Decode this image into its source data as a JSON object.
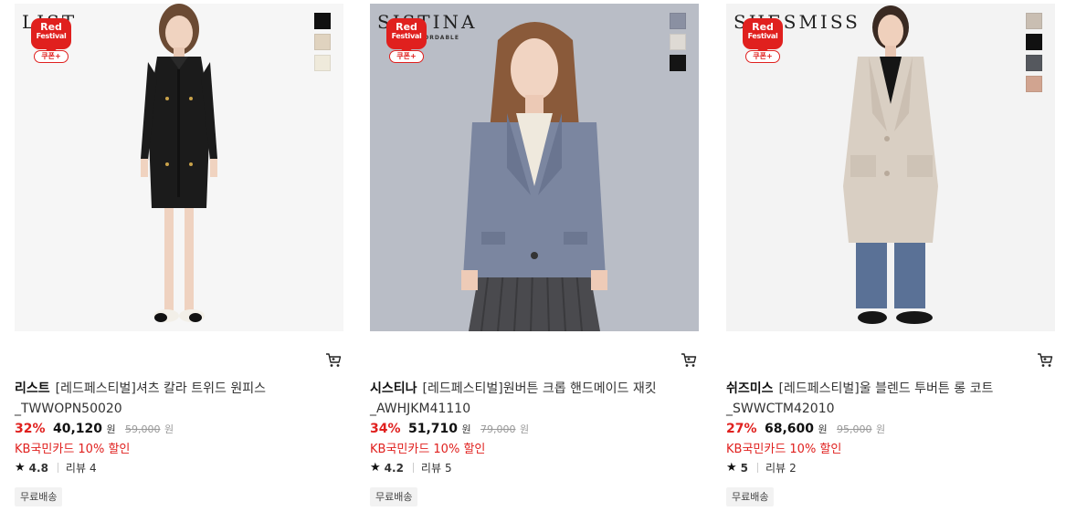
{
  "products": [
    {
      "brand_logo_text": "LIST",
      "brand_logo_sub": "",
      "badge": {
        "line1": "Red",
        "line2": "Festival",
        "coupon": "쿠폰+"
      },
      "swatches": [
        "#111111",
        "#e0d3bf",
        "#efeadb"
      ],
      "image_bg": "#f6f6f6",
      "brand": "리스트",
      "name": "[레드페스티벌]셔츠 칼라 트위드 원피스 _TWWOPN50020",
      "discount": "32%",
      "price": "40,120",
      "currency": "원",
      "original_price": "59,000",
      "card_promo": "KB국민카드 10% 할인",
      "rating": "4.8",
      "review_label": "리뷰",
      "review_count": "4",
      "shipping": "무료배송"
    },
    {
      "brand_logo_text": "SISTINA",
      "brand_logo_sub": "FORDABLE",
      "badge": {
        "line1": "Red",
        "line2": "Festival",
        "coupon": "쿠폰+"
      },
      "swatches": [
        "#8a90a2",
        "#dedad4",
        "#151515"
      ],
      "image_bg": "#b9bdc6",
      "brand": "시스티나",
      "name": "[레드페스티벌]원버튼 크롭 핸드메이드 재킷 _AWHJKM41110",
      "discount": "34%",
      "price": "51,710",
      "currency": "원",
      "original_price": "79,000",
      "card_promo": "KB국민카드 10% 할인",
      "rating": "4.2",
      "review_label": "리뷰",
      "review_count": "5",
      "shipping": "무료배송"
    },
    {
      "brand_logo_text": "SHESMISS",
      "brand_logo_sub": "",
      "badge": {
        "line1": "Red",
        "line2": "Festival",
        "coupon": "쿠폰+"
      },
      "swatches": [
        "#c9beb2",
        "#111111",
        "#55585e",
        "#d1a490"
      ],
      "image_bg": "#f3f3f3",
      "brand": "쉬즈미스",
      "name": "[레드페스티벌]울 블렌드 투버튼 롱 코트 _SWWCTM42010",
      "discount": "27%",
      "price": "68,600",
      "currency": "원",
      "original_price": "95,000",
      "card_promo": "KB국민카드 10% 할인",
      "rating": "5",
      "review_label": "리뷰",
      "review_count": "2",
      "shipping": "무료배송"
    }
  ],
  "icons": {
    "cart": "cart-icon",
    "star": "star-icon"
  },
  "colors": {
    "accent_red": "#e0201e"
  }
}
